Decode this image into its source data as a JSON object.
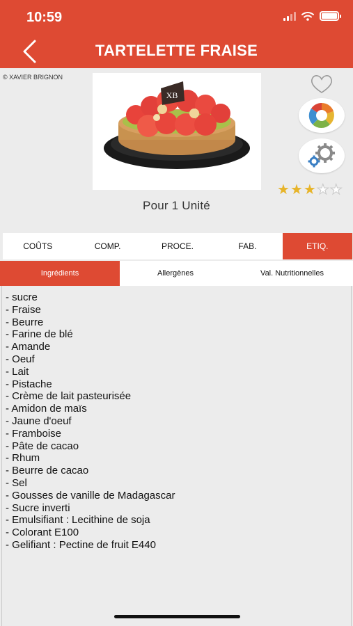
{
  "status_bar": {
    "time": "10:59"
  },
  "header": {
    "title": "TARTELETTE FRAISE",
    "back_icon": "chevron-left-icon",
    "background": "#de4a33"
  },
  "photo": {
    "credit": "© XAVIER BRIGNON",
    "logo_text": "XB",
    "description_icon": "tart-photo"
  },
  "actions": {
    "favorite_icon": "heart-outline-icon",
    "chart_icon": "pie-chart-icon",
    "settings_icon": "gears-icon"
  },
  "rating": {
    "value": 3,
    "max": 5
  },
  "portion": "Pour 1 Unité",
  "tabs": [
    {
      "label": "COÛTS",
      "active": false
    },
    {
      "label": "COMP.",
      "active": false
    },
    {
      "label": "PROCE.",
      "active": false
    },
    {
      "label": "FAB.",
      "active": false
    },
    {
      "label": "ETIQ.",
      "active": true
    }
  ],
  "subtabs": [
    {
      "label": "Ingrédients",
      "active": true
    },
    {
      "label": "Allergènes",
      "active": false
    },
    {
      "label": "Val. Nutritionnelles",
      "active": false
    }
  ],
  "ingredients": [
    "- sucre",
    "- Fraise",
    "- Beurre",
    "- Farine de blé",
    "- Amande",
    "- Oeuf",
    "- Lait",
    "- Pistache",
    "- Crème de lait pasteurisée",
    "- Amidon de maïs",
    "- Jaune d'oeuf",
    "- Framboise",
    "- Pâte de cacao",
    "- Rhum",
    "- Beurre de cacao",
    "- Sel",
    "- Gousses de vanille de Madagascar",
    "- Sucre inverti",
    "- Emulsifiant : Lecithine de soja",
    "- Colorant E100",
    "- Gelifiant : Pectine de fruit E440"
  ]
}
